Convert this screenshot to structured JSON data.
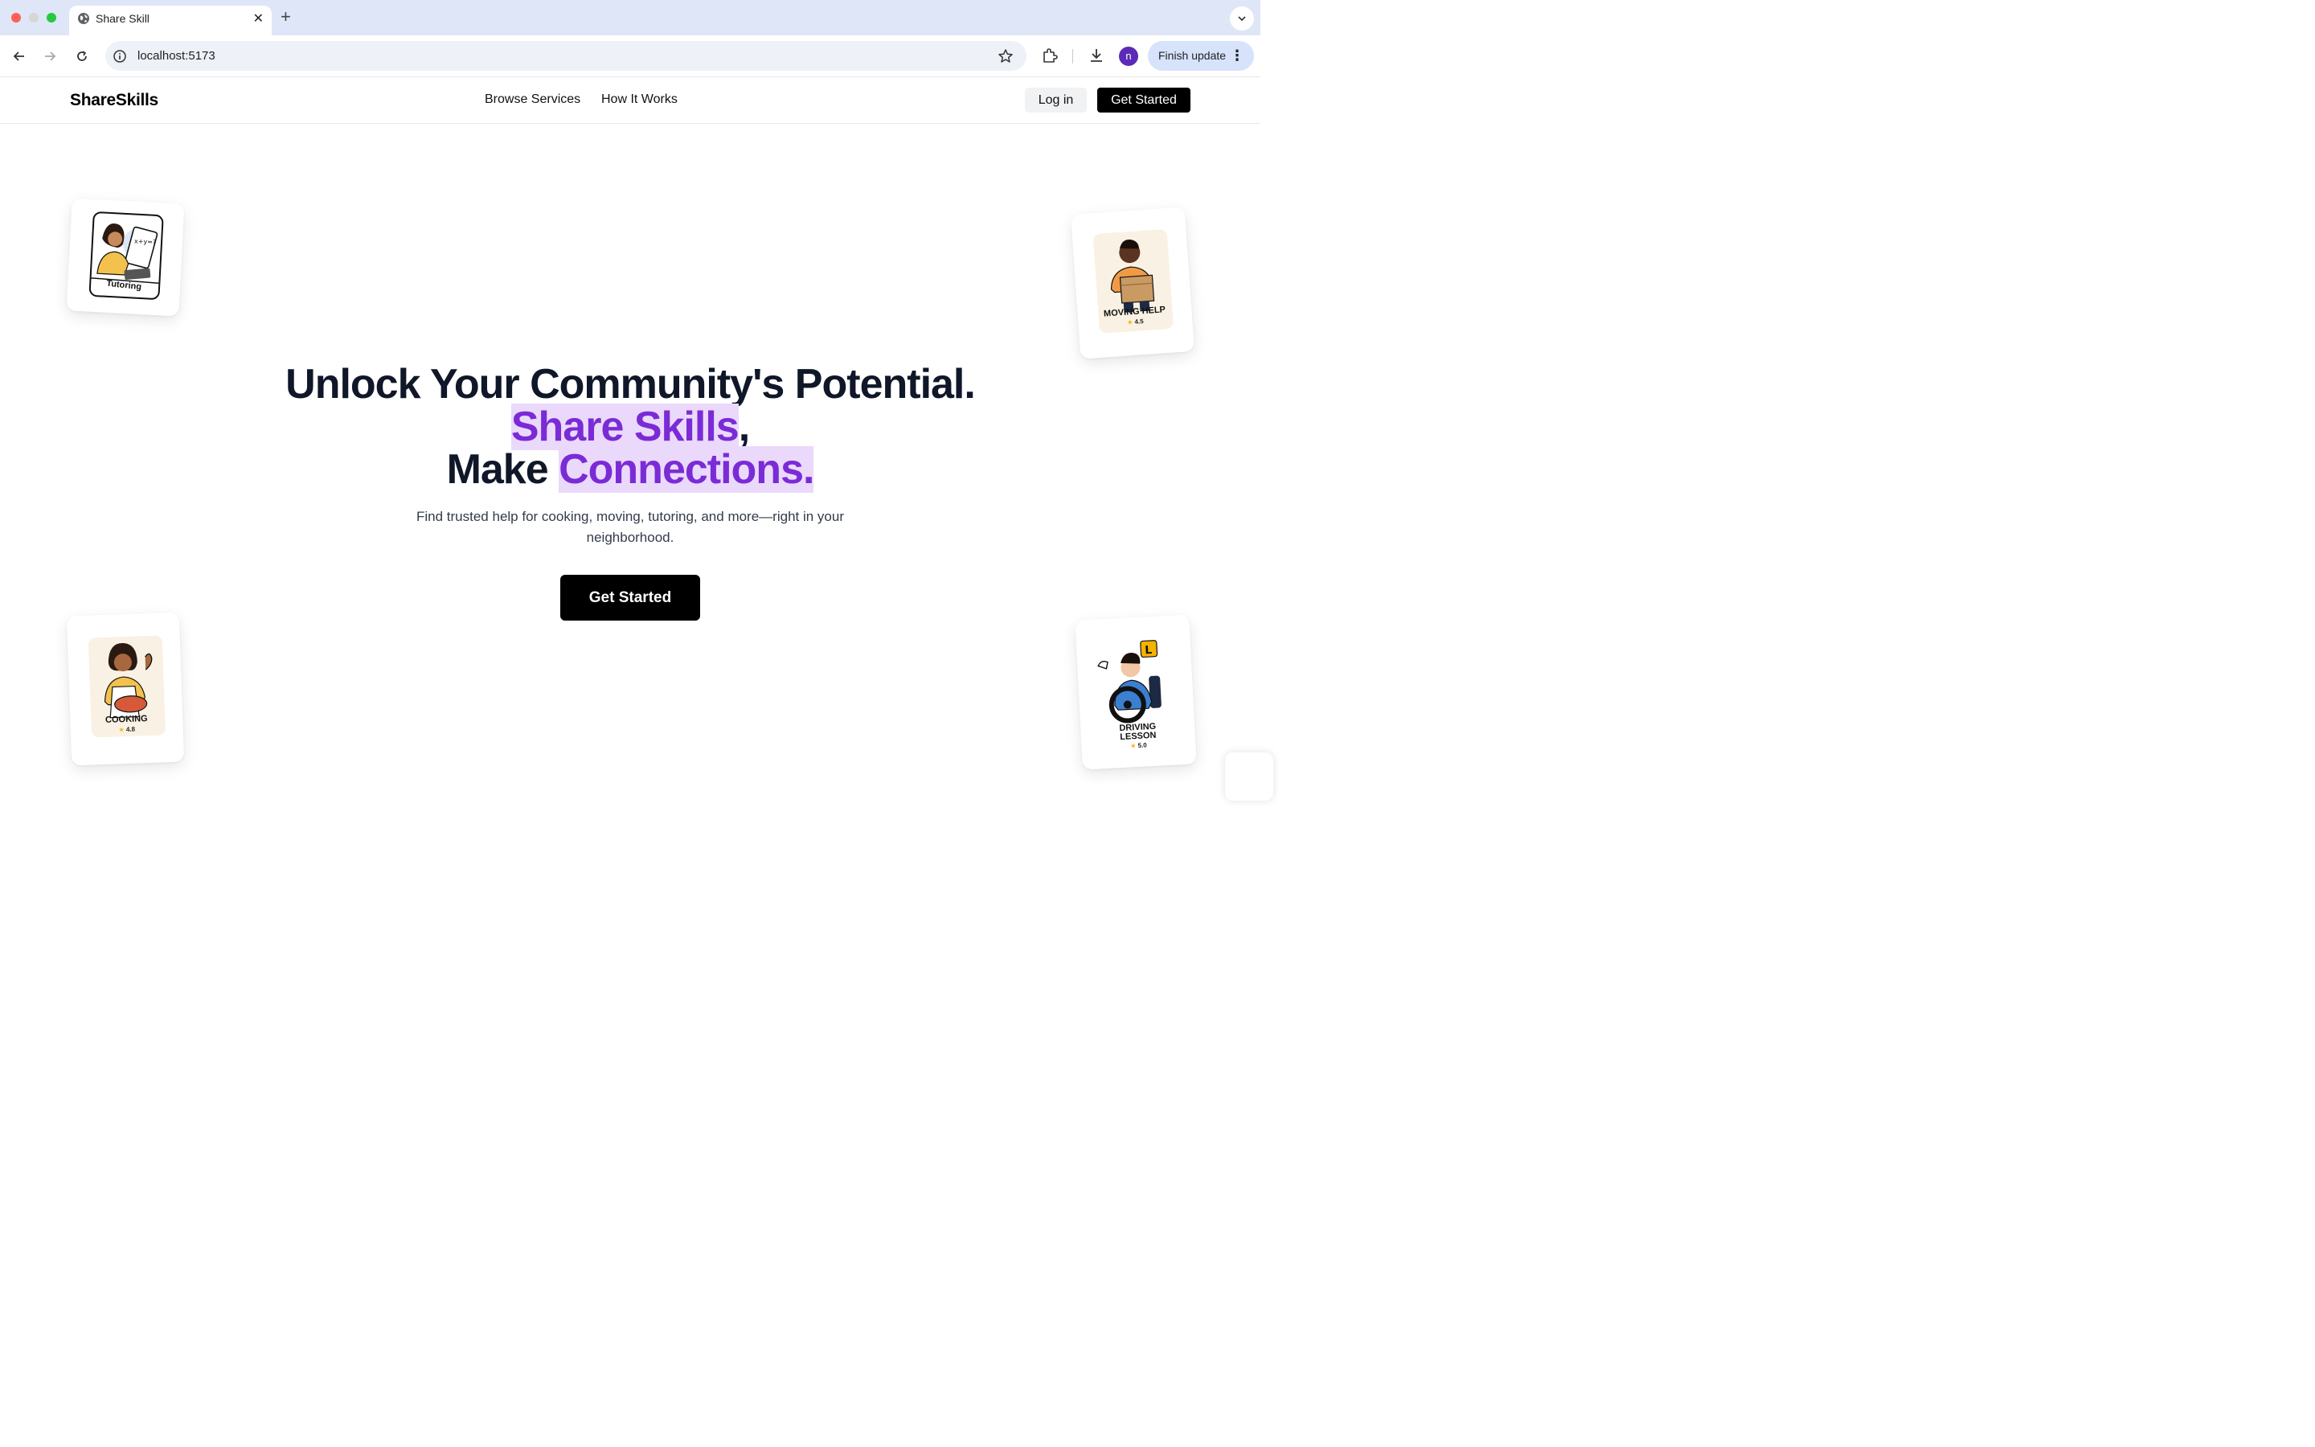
{
  "browser": {
    "tab_title": "Share Skill",
    "url": "localhost:5173",
    "profile_initial": "n",
    "finish_update_label": "Finish update"
  },
  "header": {
    "logo": "ShareSkills",
    "nav": [
      "Browse Services",
      "How It Works"
    ],
    "login_label": "Log in",
    "get_started_label": "Get Started"
  },
  "hero": {
    "title_line1": "Unlock Your Community's Potential.",
    "title_line2_highlight": "Share Skills",
    "title_line2_suffix": ",",
    "title_line3_prefix": "Make ",
    "title_line3_highlight": "Connections.",
    "subtitle": "Find trusted help for cooking, moving, tutoring, and more—right in your neighborhood.",
    "cta_label": "Get Started"
  },
  "cards": {
    "tutoring": {
      "label": "Tutoring",
      "board_text": "x+y=?"
    },
    "moving": {
      "label": "MOVING HELP",
      "rating": "4.5"
    },
    "cooking": {
      "label": "COOKING",
      "rating": "4.8"
    },
    "driving": {
      "label_line1": "DRIVING",
      "label_line2": "LESSON",
      "rating": "5.0",
      "plate": "L"
    }
  },
  "colors": {
    "accent": "#7a2bd6",
    "highlight_bg": "#ead9fb",
    "cta_bg": "#000000"
  }
}
